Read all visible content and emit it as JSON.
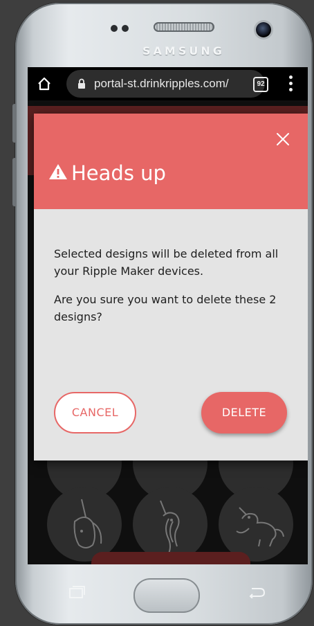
{
  "device": {
    "brand_label": "SAMSUNG"
  },
  "browser": {
    "url": "portal-st.drinkripples.com/",
    "tab_count": "92",
    "icons": [
      "home-icon",
      "lock-icon",
      "tabs-icon",
      "more-vert-icon"
    ]
  },
  "dialog": {
    "title": "Heads up",
    "title_icon": "warning-icon",
    "close_icon": "close-icon",
    "message_1": "Selected designs will be deleted from all your Ripple Maker devices.",
    "message_2": "Are you sure you want to delete these 2 designs?",
    "cancel_label": "CANCEL",
    "delete_label": "DELETE",
    "colors": {
      "header": "#e76766",
      "body": "#e4e4e4",
      "accent": "#e76766"
    }
  },
  "background_gallery": {
    "icons": [
      "unicorn-head-icon",
      "unicorn-mane-icon",
      "flying-unicorn-icon"
    ]
  }
}
